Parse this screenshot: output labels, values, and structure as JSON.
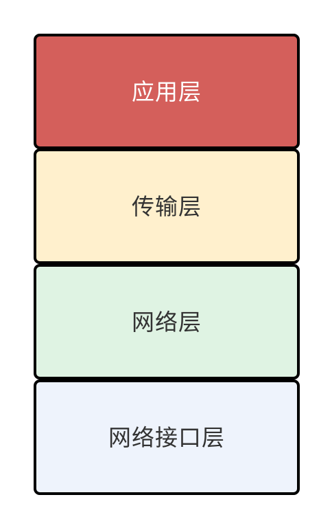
{
  "diagram": {
    "layers": [
      {
        "label": "应用层",
        "fill": "#d45f5b",
        "text_color": "#ffffff"
      },
      {
        "label": "传输层",
        "fill": "#fff0cd",
        "text_color": "#333333"
      },
      {
        "label": "网络层",
        "fill": "#dff3e3",
        "text_color": "#333333"
      },
      {
        "label": "网络接口层",
        "fill": "#eef3fc",
        "text_color": "#333333"
      }
    ],
    "border_color": "#000000"
  }
}
